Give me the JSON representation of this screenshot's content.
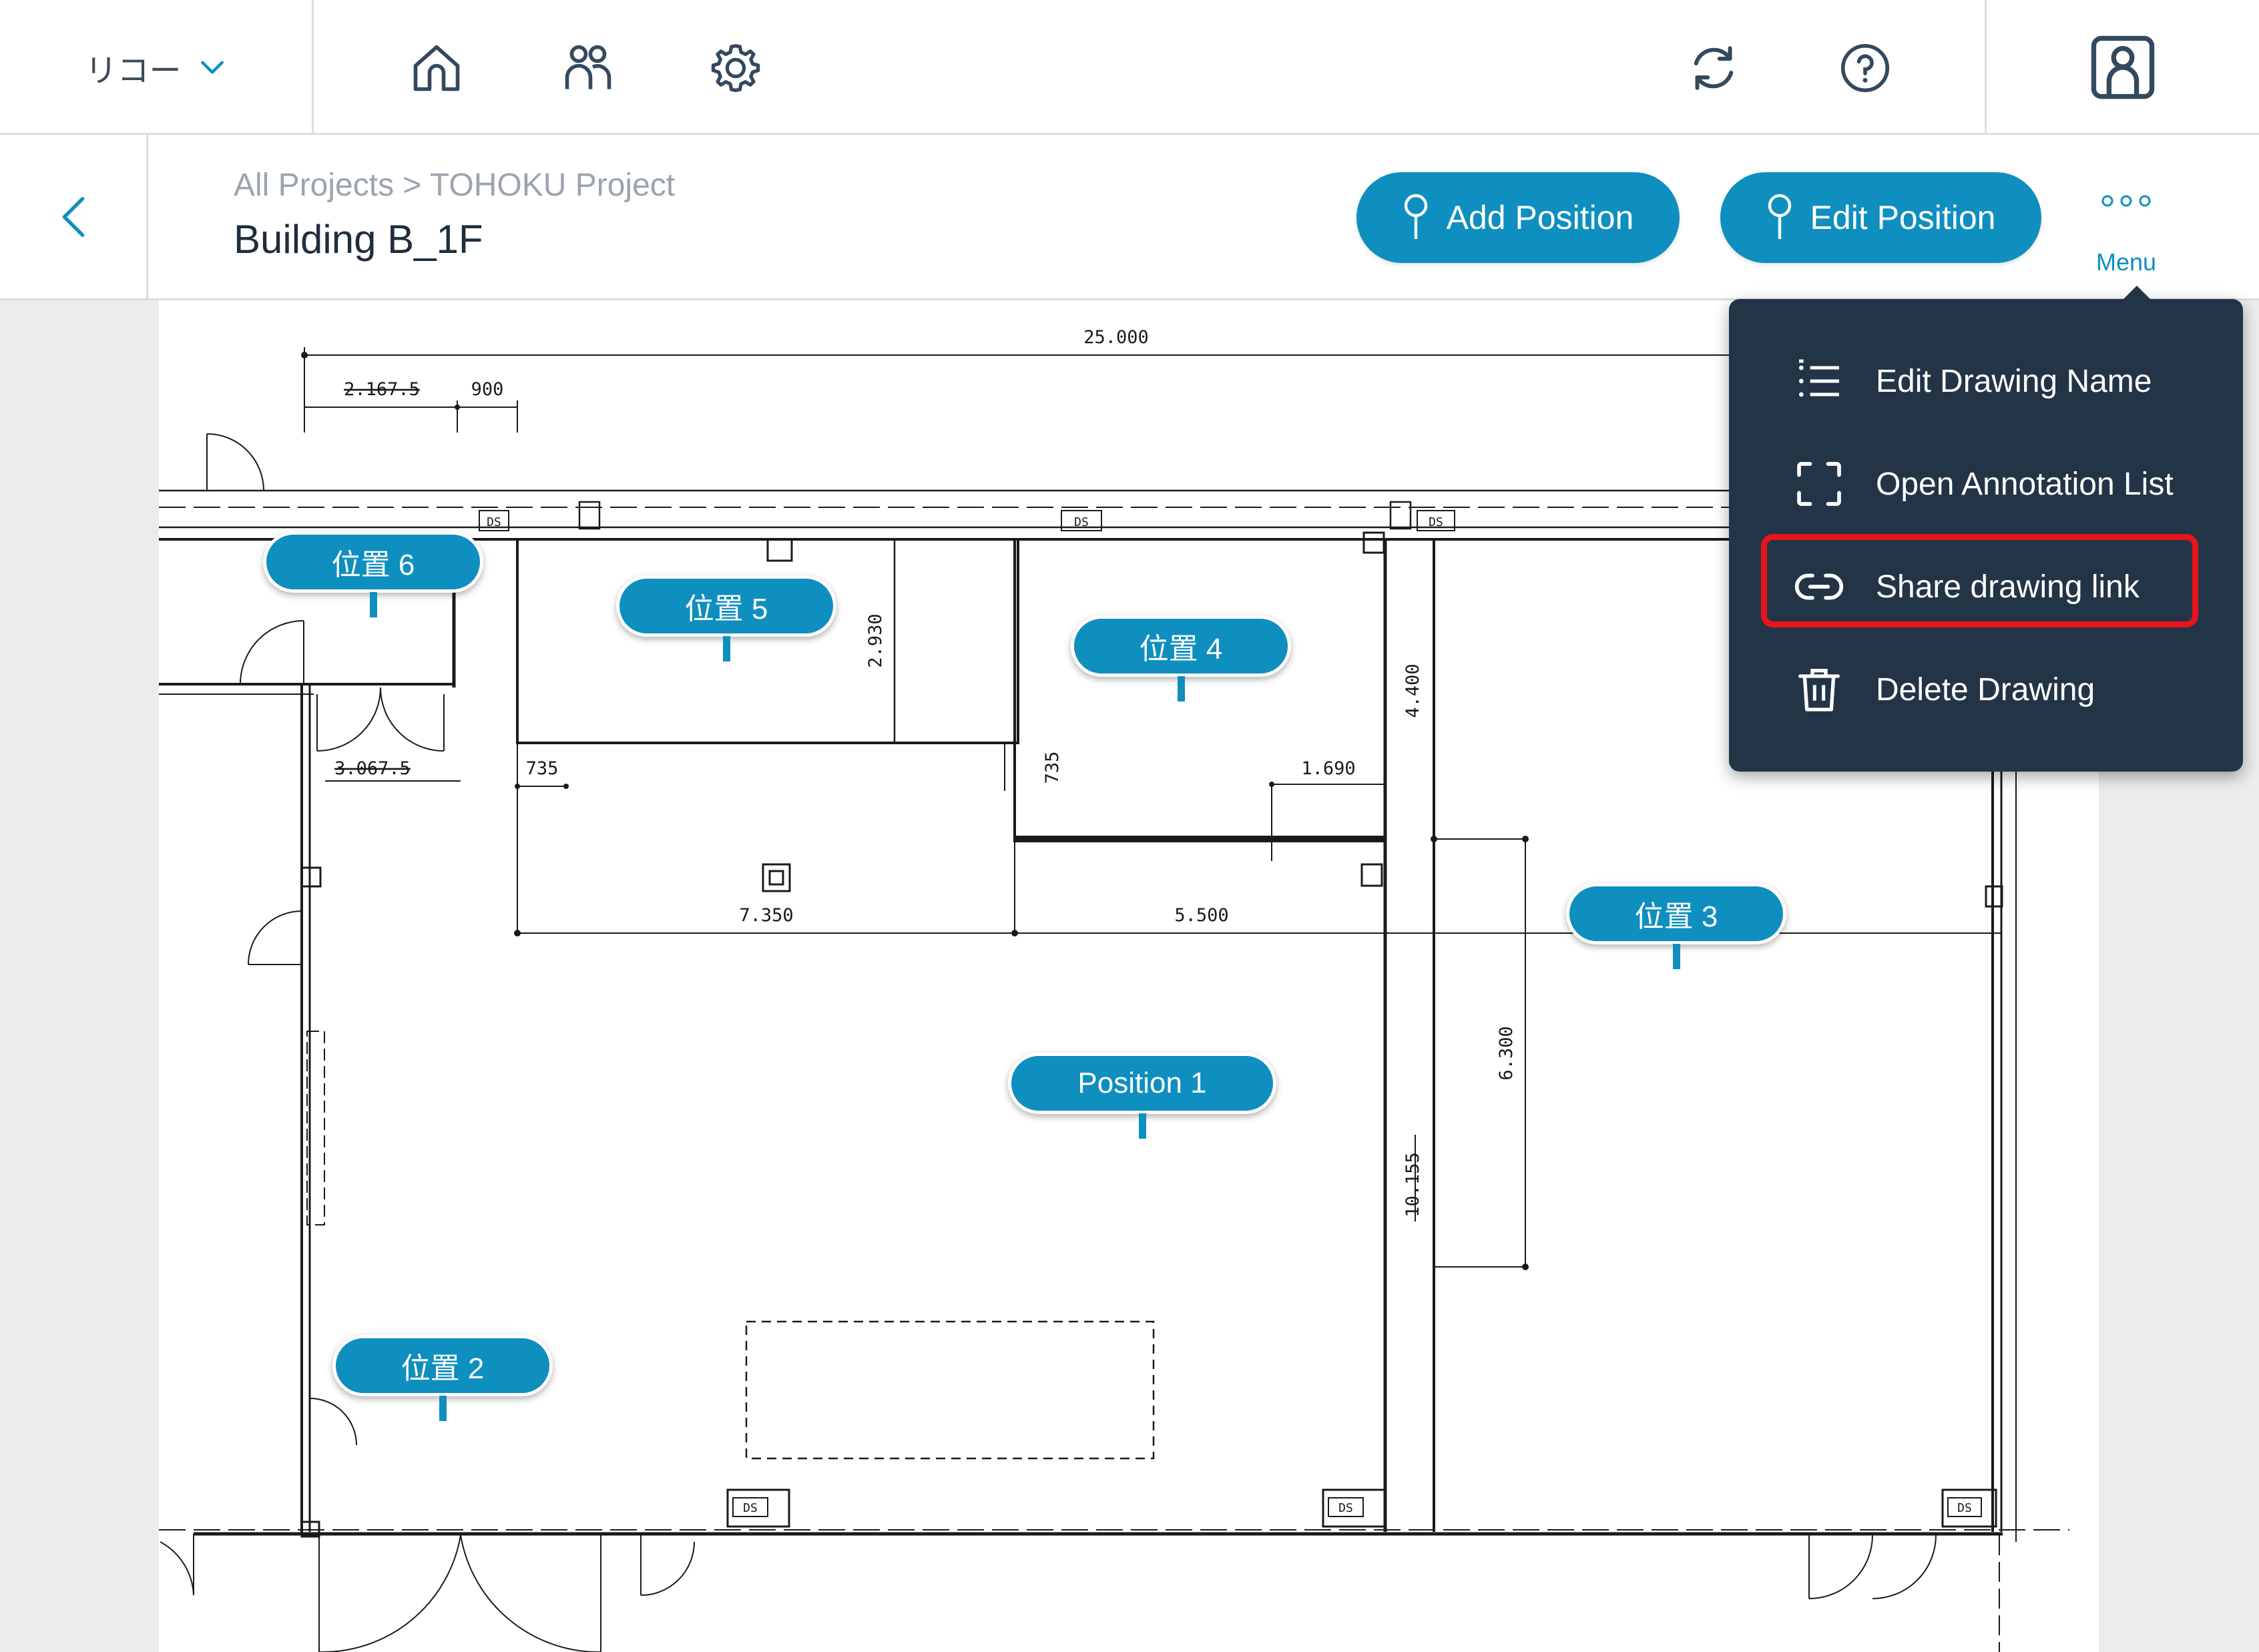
{
  "topbar": {
    "org_name": "リコー",
    "org_icon": "chevron-down-icon",
    "nav_icons": [
      "home-icon",
      "users-icon",
      "gear-icon",
      "sync-icon",
      "help-icon",
      "account-icon"
    ]
  },
  "header": {
    "breadcrumb": "All Projects > TOHOKU Project",
    "title": "Building B_1F",
    "add_position_label": "Add Position",
    "edit_position_label": "Edit Position",
    "menu_label": "Menu"
  },
  "menu": {
    "items": [
      {
        "label": "Edit Drawing Name",
        "icon": "list-icon"
      },
      {
        "label": "Open Annotation List",
        "icon": "frame-icon"
      },
      {
        "label": "Share drawing link",
        "icon": "link-icon"
      },
      {
        "label": "Delete Drawing",
        "icon": "trash-icon"
      }
    ],
    "highlighted_item": "Share drawing link",
    "highlight_color": "#e8141b"
  },
  "drawing": {
    "dimensions": {
      "total_width": "25.000",
      "d_2167": "2.167.5",
      "d_900": "900",
      "d_3067": "3.067.5",
      "d_735a": "735",
      "d_735b": "735",
      "d_2930": "2.930",
      "d_4400": "4.400",
      "d_1690": "1.690",
      "d_7350": "7.350",
      "d_5500": "5.500",
      "d_6300": "6.300",
      "d_10155": "10.155"
    },
    "ds_label": "DS",
    "pins": {
      "p6": "位置 6",
      "p5": "位置 5",
      "p4": "位置 4",
      "p3": "位置 3",
      "p1": "Position 1",
      "p2": "位置 2"
    }
  },
  "colors": {
    "accent": "#0e8fbf",
    "menu_bg": "#233447",
    "page_bg": "#ececec"
  }
}
